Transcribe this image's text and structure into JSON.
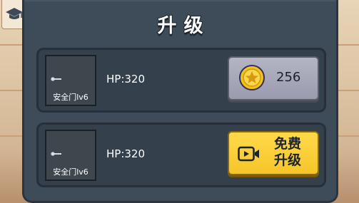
{
  "dialog": {
    "title": "升级"
  },
  "items": [
    {
      "thumb_label": "安全门lv6",
      "hp": "HP:320",
      "action": {
        "type": "coin",
        "price": "256"
      }
    },
    {
      "thumb_label": "安全门lv6",
      "hp": "HP:320",
      "action": {
        "type": "video",
        "label_line1": "免费",
        "label_line2": "升级"
      }
    }
  ],
  "colors": {
    "panel": "#3e4c5a",
    "card": "#34404c",
    "coin_button": "#a7a9b9",
    "free_button": "#f9cf38",
    "coin_gold": "#f3c21f"
  },
  "icons": {
    "side": "graduation-cap-icon",
    "thumb": "key-icon",
    "coin": "star-coin-icon",
    "video": "video-play-icon"
  }
}
